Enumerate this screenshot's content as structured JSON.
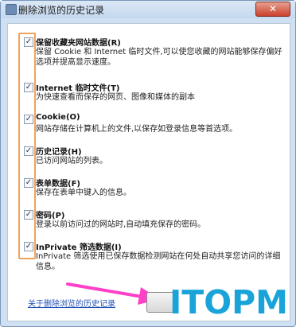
{
  "window": {
    "title": "删除浏览的历史记录",
    "close_label": "✕"
  },
  "options": [
    {
      "checked": true,
      "title": "保留收藏夹网站数据(R)",
      "desc": "保留 Cookie 和 Internet 临时文件,可以使您收藏的网站能够保存偏好选项并提高显示速度。"
    },
    {
      "checked": true,
      "title": "Internet 临时文件(T)",
      "desc": "为快速查看而保存的网页、图像和媒体的副本"
    },
    {
      "checked": true,
      "title": "Cookie(O)",
      "desc": "网站存储在计算机上的文件,以保存如登录信息等首选项。"
    },
    {
      "checked": true,
      "title": "历史记录(H)",
      "desc": "已访问网站的列表。"
    },
    {
      "checked": true,
      "title": "表单数据(F)",
      "desc": "保存在表单中键入的信息。"
    },
    {
      "checked": true,
      "title": "密码(P)",
      "desc": "登录以前访问过的网站时,自动填充保存的密码。"
    },
    {
      "checked": true,
      "title": "InPrivate 筛选数据(I)",
      "desc": "InPrivate 筛选使用已保存数据检测网站在何处自动共享您访问的详细信息。"
    }
  ],
  "footer": {
    "link": "关于删除浏览的历史记录"
  },
  "watermark": "ITOPM",
  "colors": {
    "highlight": "#f0a35c",
    "arrow": "#ff40c8",
    "watermark": "#1aa3d9",
    "link": "#1f4fb6"
  }
}
